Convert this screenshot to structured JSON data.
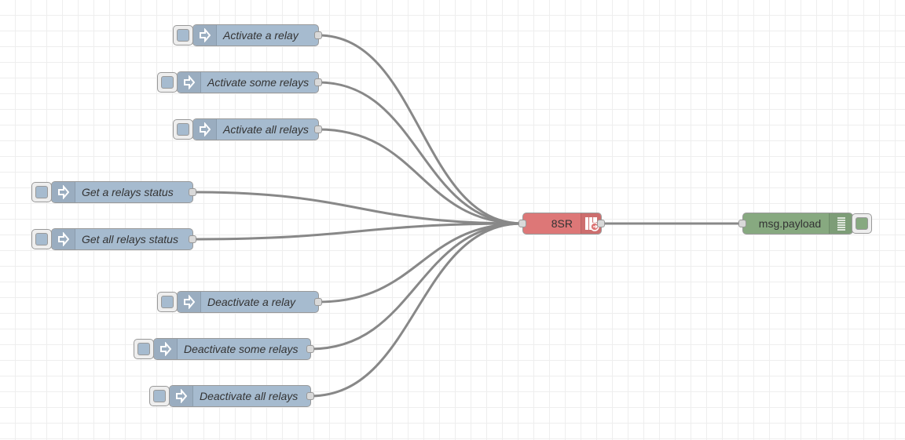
{
  "flow": {
    "inject_nodes": [
      {
        "label": "Activate a relay",
        "icon": "inject-arrow-icon"
      },
      {
        "label": "Activate some relays",
        "icon": "inject-arrow-icon"
      },
      {
        "label": "Activate all relays",
        "icon": "inject-arrow-icon"
      },
      {
        "label": "Get a relays status",
        "icon": "inject-arrow-icon"
      },
      {
        "label": "Get all relays status",
        "icon": "inject-arrow-icon"
      },
      {
        "label": "Deactivate a relay",
        "icon": "inject-arrow-icon"
      },
      {
        "label": "Deactivate some relays",
        "icon": "inject-arrow-icon"
      },
      {
        "label": "Deactivate all relays",
        "icon": "inject-arrow-icon"
      }
    ],
    "relay_node": {
      "label": "8SR",
      "icon": "relay-board-icon",
      "color": "#dd7777"
    },
    "debug_node": {
      "label": "msg.payload",
      "icon": "debug-list-icon",
      "color": "#87a980"
    },
    "colors": {
      "inject": "#a6bbcf",
      "wire": "#888888",
      "grid": "#eeeeee"
    }
  }
}
